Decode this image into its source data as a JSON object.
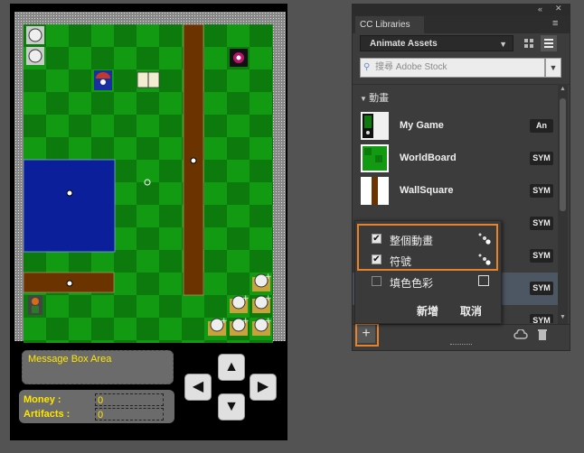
{
  "game": {
    "message_box": "Message Box Area",
    "money_label": "Money :",
    "money_value": "0",
    "artifacts_label": "Artifacts :",
    "artifacts_value": "0"
  },
  "panel": {
    "tab_title": "CC Libraries",
    "library_select": "Animate Assets",
    "search_placeholder": "搜尋 Adobe Stock",
    "section_title": "動畫",
    "assets": [
      {
        "name": "My Game",
        "badge": "An"
      },
      {
        "name": "WorldBoard",
        "badge": "SYM"
      },
      {
        "name": "WallSquare",
        "badge": "SYM"
      },
      {
        "name": "",
        "badge": "SYM"
      },
      {
        "name": "",
        "badge": "SYM"
      },
      {
        "name": "",
        "badge": "SYM"
      },
      {
        "name": "",
        "badge": "SYM"
      }
    ]
  },
  "popup": {
    "options": [
      {
        "label": "整個動畫",
        "checked": true
      },
      {
        "label": "符號",
        "checked": true
      },
      {
        "label": "填色色彩",
        "checked": false
      }
    ],
    "add_label": "新增",
    "cancel_label": "取消"
  },
  "colors": {
    "highlight": "#e8832c",
    "game_text": "#ffe600",
    "board_dark": "#0d7a0d",
    "board_light": "#139a13",
    "wall": "#6b3300",
    "water": "#0b1f9a"
  },
  "icons": [
    "collapse-icon",
    "panel-menu-icon",
    "grid-view-icon",
    "list-view-icon",
    "search-icon",
    "dropdown-icon",
    "add-icon",
    "creative-cloud-icon",
    "trash-icon"
  ]
}
